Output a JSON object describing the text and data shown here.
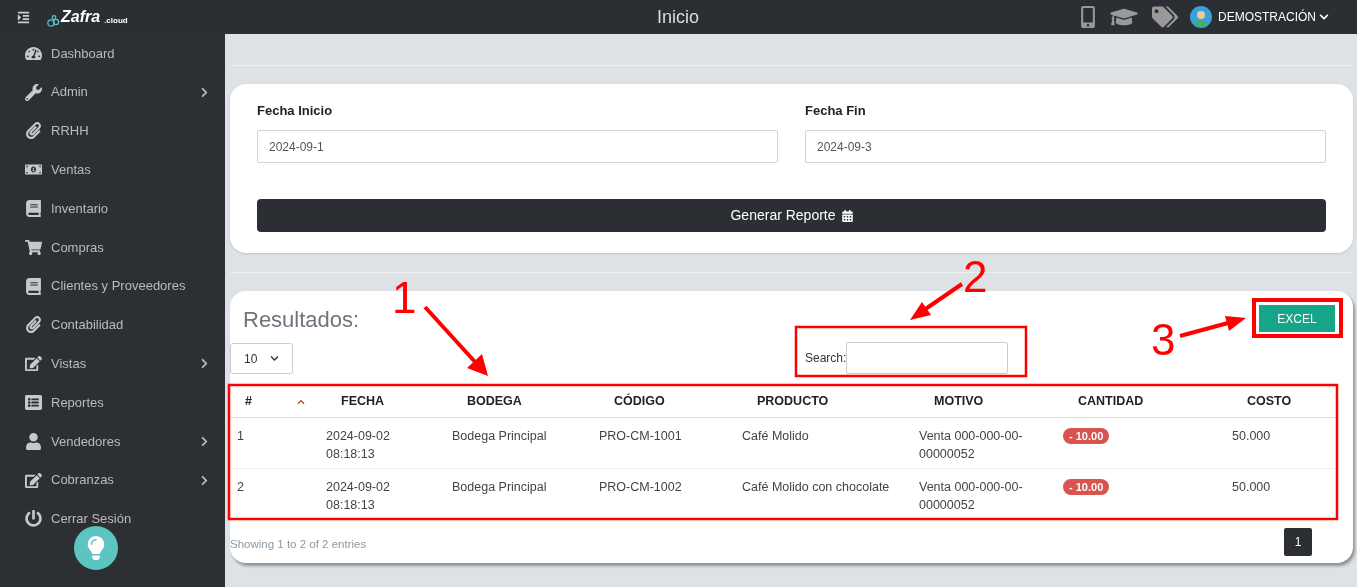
{
  "topbar": {
    "logo": "Zafra",
    "logo_suffix": ".cloud",
    "title": "Inicio",
    "user": "DEMOSTRACIÓN"
  },
  "sidebar": {
    "items": [
      {
        "label": "Dashboard",
        "expandable": false
      },
      {
        "label": "Admin",
        "expandable": true
      },
      {
        "label": "RRHH",
        "expandable": false
      },
      {
        "label": "Ventas",
        "expandable": false
      },
      {
        "label": "Inventario",
        "expandable": false
      },
      {
        "label": "Compras",
        "expandable": false
      },
      {
        "label": "Clientes y Proveedores",
        "expandable": false
      },
      {
        "label": "Contabilidad",
        "expandable": false
      },
      {
        "label": "Vistas",
        "expandable": true
      },
      {
        "label": "Reportes",
        "expandable": false
      },
      {
        "label": "Vendedores",
        "expandable": true
      },
      {
        "label": "Cobranzas",
        "expandable": true
      },
      {
        "label": "Cerrar Sesión",
        "expandable": false
      }
    ]
  },
  "filters": [
    {
      "label": "Fecha Inicio",
      "value": "2024-09-1"
    },
    {
      "label": "Fecha Fin",
      "value": "2024-09-3"
    }
  ],
  "generate_button": "Generar Reporte",
  "results": {
    "title": "Resultados:",
    "page_size": "10",
    "search_label": "Search:",
    "excel_button": "EXCEL",
    "columns": [
      "#",
      "FECHA",
      "BODEGA",
      "CÓDIGO",
      "PRODUCTO",
      "MOTIVO",
      "CANTIDAD",
      "COSTO"
    ],
    "rows": [
      {
        "cells": [
          "1",
          "2024-09-02 08:18:13",
          "Bodega Principal",
          "PRO-CM-1001",
          "Café Molido",
          "Venta 000-000-00-00000052",
          "- 10.00",
          "50.000"
        ]
      },
      {
        "cells": [
          "2",
          "2024-09-02 08:18:13",
          "Bodega Principal",
          "PRO-CM-1002",
          "Café Molido con chocolate",
          "Venta 000-000-00-00000052",
          "- 10.00",
          "50.000"
        ]
      }
    ],
    "info": "Showing 1 to 2 of 2 entries",
    "pages": [
      {
        "label": "1",
        "selected": true
      }
    ]
  },
  "annotations": [
    {
      "label": "1"
    },
    {
      "label": "2"
    },
    {
      "label": "3"
    }
  ]
}
